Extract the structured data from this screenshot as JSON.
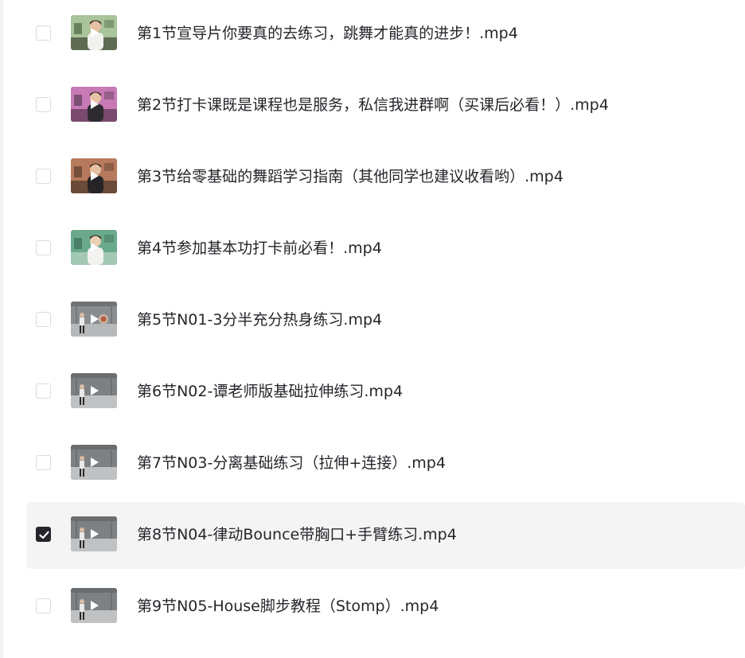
{
  "files": [
    {
      "name": "第1节宣导片你要真的去练习，跳舞才能真的进步！.mp4",
      "selected": false,
      "thumb_style": "green-room"
    },
    {
      "name": "第2节打卡课既是课程也是服务，私信我进群啊（买课后必看！）.mp4",
      "selected": false,
      "thumb_style": "pink-room"
    },
    {
      "name": "第3节给零基础的舞蹈学习指南（其他同学也建议收看哟）.mp4",
      "selected": false,
      "thumb_style": "warm-room"
    },
    {
      "name": "第4节参加基本功打卡前必看！.mp4",
      "selected": false,
      "thumb_style": "teal-room"
    },
    {
      "name": "第5节N01-3分半充分热身练习.mp4",
      "selected": false,
      "thumb_style": "studio-badge"
    },
    {
      "name": "第6节N02-谭老师版基础拉伸练习.mp4",
      "selected": false,
      "thumb_style": "studio"
    },
    {
      "name": "第7节N03-分离基础练习（拉伸+连接）.mp4",
      "selected": false,
      "thumb_style": "studio"
    },
    {
      "name": "第8节N04-律动Bounce带胸口+手臂练习.mp4",
      "selected": true,
      "thumb_style": "studio"
    },
    {
      "name": "第9节N05-House脚步教程（Stomp）.mp4",
      "selected": false,
      "thumb_style": "studio"
    }
  ],
  "icons": {
    "checkbox": "checkbox-icon",
    "checkmark": "checkmark-icon",
    "play": "play-icon"
  },
  "colors": {
    "text": "#25262b",
    "selected_row": "#f4f4f4",
    "checkbox_border": "#d9dbe0",
    "checkbox_checked": "#25262b"
  }
}
